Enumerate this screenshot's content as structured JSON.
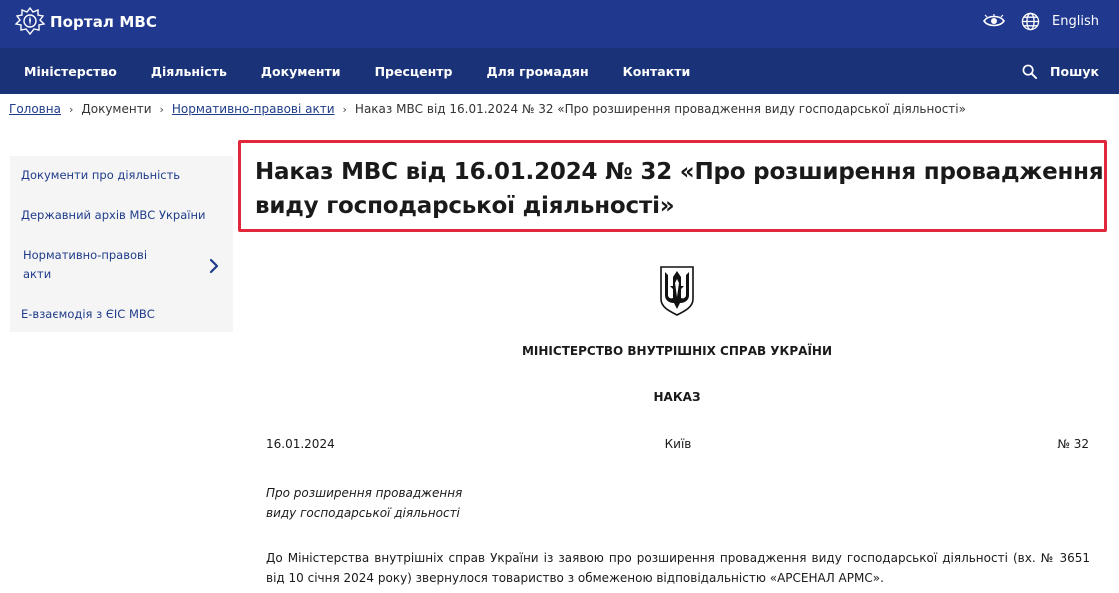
{
  "header": {
    "logo_text": "Портал МВС",
    "language_label": "English"
  },
  "nav": {
    "items": [
      "Міністерство",
      "Діяльність",
      "Документи",
      "Пресцентр",
      "Для громадян",
      "Контакти"
    ],
    "search_label": "Пошук"
  },
  "breadcrumb": {
    "home": "Головна",
    "documents": "Документи",
    "normative": "Нормативно-правові акти",
    "current": "Наказ МВС від 16.01.2024 № 32 «Про розширення провадження виду господарської діяльності»"
  },
  "sidebar": {
    "items": [
      {
        "label": "Документи про діяльність"
      },
      {
        "label": "Державний архів МВС України"
      },
      {
        "label_line1": "Нормативно-правові",
        "label_line2": "акти"
      },
      {
        "label": "Е-взаємодія з ЄІС МВС"
      }
    ]
  },
  "page": {
    "title": "Наказ МВС від 16.01.2024 № 32 «Про розширення провадження виду господарської діяльності»"
  },
  "document": {
    "ministry": "МІНІСТЕРСТВО ВНУТРІШНІХ СПРАВ УКРАЇНИ",
    "order_label": "НАКАЗ",
    "date": "16.01.2024",
    "city": "Київ",
    "number": "№ 32",
    "subject_line1": "Про розширення провадження",
    "subject_line2": "виду господарської діяльності",
    "body": "До Міністерства внутрішніх справ України із заявою про розширення провадження виду господарської діяльності (вх. № 3651 від 10 січня 2024 року) звернулося товариство з обмеженою відповідальністю «АРСЕНАЛ АРМС»."
  },
  "colors": {
    "topbar": "#20398f",
    "navbar": "#1a3277",
    "link": "#1f3c8a",
    "title_border": "#e0283a"
  }
}
